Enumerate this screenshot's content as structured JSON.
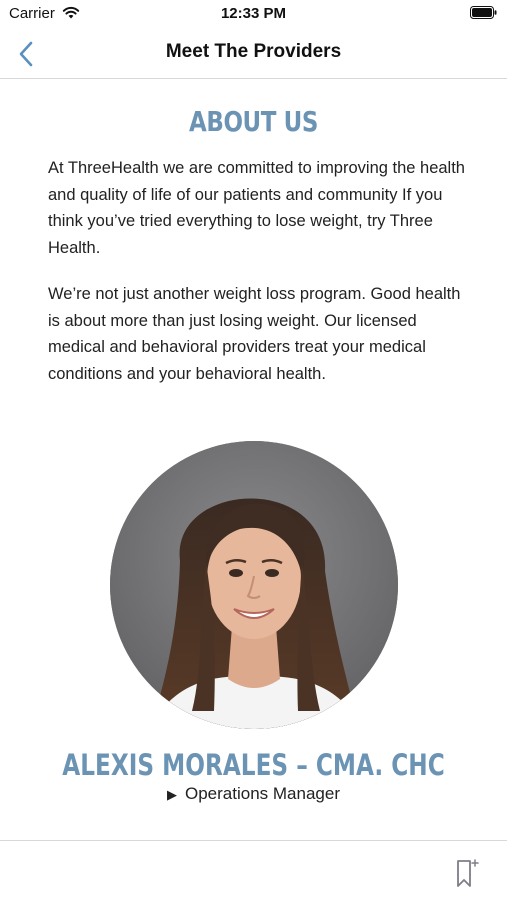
{
  "status_bar": {
    "carrier": "Carrier",
    "time": "12:33 PM"
  },
  "nav": {
    "title": "Meet The Providers"
  },
  "about": {
    "heading": "ABOUT US",
    "paragraph1": "At ThreeHealth we are committed to improving the health and quality of life of our patients and community If you think you’ve tried everything to lose weight, try Three Health.",
    "paragraph2": "We’re not just another weight loss program. Good health is about more than just losing weight. Our licensed medical and behavioral providers treat your medical conditions and your behavioral health."
  },
  "provider": {
    "name": "ALEXIS MORALES – CMA. CHC",
    "role": "Operations Manager"
  },
  "colors": {
    "accent": "#6b93b4",
    "ios_blue": "#5a8fc0"
  },
  "icons": {
    "back": "chevron-left-icon",
    "wifi": "wifi-icon",
    "battery": "battery-icon",
    "bookmark": "bookmark-add-icon",
    "role_disclosure": "triangle-right-icon"
  }
}
